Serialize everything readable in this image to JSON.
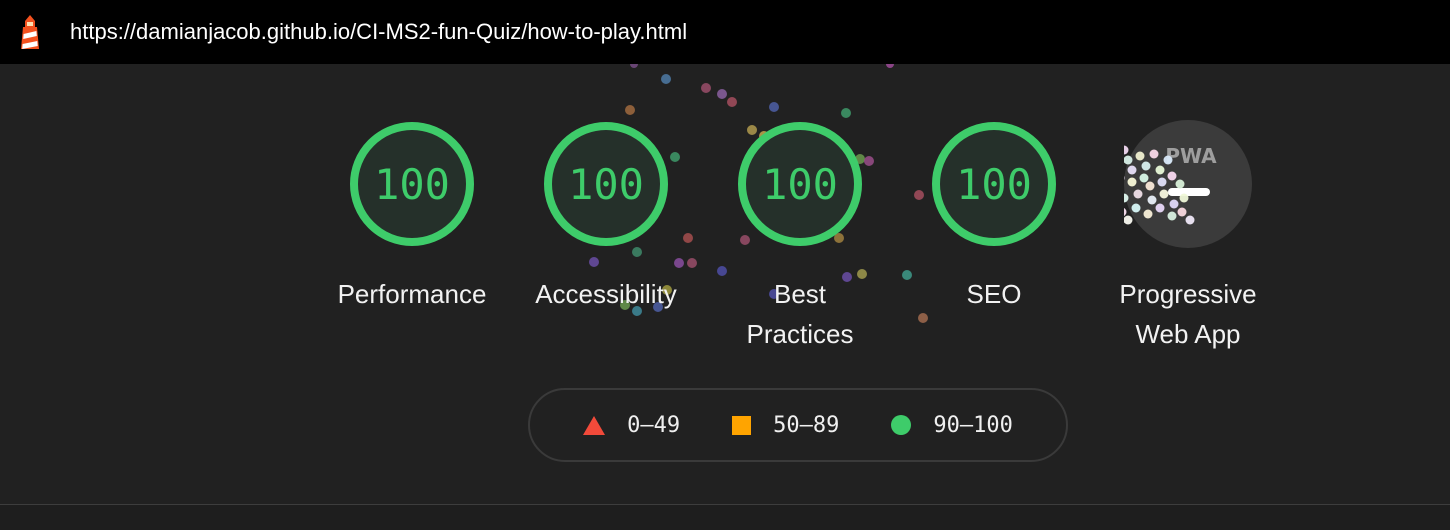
{
  "header": {
    "url": "https://damianjacob.github.io/CI-MS2-fun-Quiz/how-to-play.html",
    "logo_icon": "lighthouse-icon"
  },
  "gauges": [
    {
      "id": "performance",
      "score": "100",
      "label": "Performance",
      "score_fraction": 1.0
    },
    {
      "id": "accessibility",
      "score": "100",
      "label": "Accessibility",
      "score_fraction": 1.0
    },
    {
      "id": "best-practices",
      "score": "100",
      "label": "Best Practices",
      "score_fraction": 1.0
    },
    {
      "id": "seo",
      "score": "100",
      "label": "SEO",
      "score_fraction": 1.0
    }
  ],
  "pwa": {
    "badge": "PWA",
    "label": "Progressive Web App",
    "icon": "pwa-dash-icon"
  },
  "legend": {
    "fail": "0–49",
    "average": "50–89",
    "pass": "90–100"
  },
  "colors": {
    "pass": "#3ecc6a",
    "average": "#ffa400",
    "fail": "#f24a3a",
    "ring_bg": "#25302a",
    "pwa_bg": "#3b3b3b",
    "header_bg": "#000000",
    "page_bg": "#212121"
  }
}
